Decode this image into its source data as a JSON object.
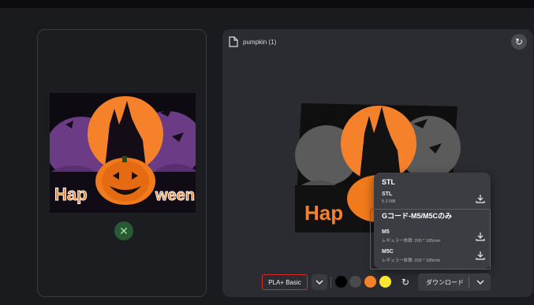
{
  "file": {
    "name": "pumpkin (1)"
  },
  "poster": {
    "text_left": "Hap",
    "text_right": "ween"
  },
  "download_menu": {
    "stl_section_title": "STL",
    "stl_item": {
      "title": "STL",
      "size": "5.2 MB"
    },
    "gcode_section_title": "Gコード-M5/M5Cのみ",
    "gcode_items": [
      {
        "title": "M5",
        "volume": "レギュラー体積: 200 * 185mm"
      },
      {
        "title": "M5C",
        "volume": "レギュラー体積: 200 * 185mm"
      }
    ]
  },
  "toolbar": {
    "material_label": "PLA+ Basic",
    "swatches": [
      "#000000",
      "#4a4a4a",
      "#f5812b",
      "#fce730"
    ],
    "download_label": "ダウンロード"
  },
  "colors": {
    "accent_red": "#d42a2a",
    "panel": "#2b2c31",
    "orange": "#f5812b",
    "purple": "#6b3b86"
  }
}
